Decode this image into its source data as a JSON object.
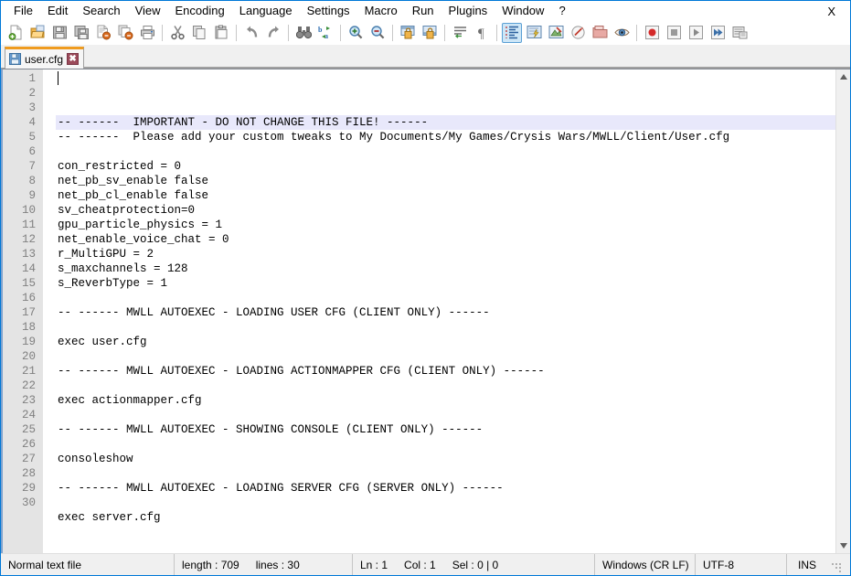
{
  "window": {
    "title": "user.cfg - Notepad++",
    "close_label": "X",
    "accent_color": "#0078d7",
    "tab_active_color": "#ef9b1f"
  },
  "menubar": {
    "items": [
      {
        "name": "file",
        "label": "File"
      },
      {
        "name": "edit",
        "label": "Edit"
      },
      {
        "name": "search",
        "label": "Search"
      },
      {
        "name": "view",
        "label": "View"
      },
      {
        "name": "encoding",
        "label": "Encoding"
      },
      {
        "name": "language",
        "label": "Language"
      },
      {
        "name": "settings",
        "label": "Settings"
      },
      {
        "name": "macro",
        "label": "Macro"
      },
      {
        "name": "run",
        "label": "Run"
      },
      {
        "name": "plugins",
        "label": "Plugins"
      },
      {
        "name": "window",
        "label": "Window"
      },
      {
        "name": "help",
        "label": "?"
      }
    ]
  },
  "toolbar": {
    "buttons": [
      {
        "name": "new-file-icon",
        "title": "New"
      },
      {
        "name": "open-file-icon",
        "title": "Open"
      },
      {
        "name": "save-icon",
        "title": "Save"
      },
      {
        "name": "save-all-icon",
        "title": "Save All"
      },
      {
        "name": "close-file-icon",
        "title": "Close"
      },
      {
        "name": "close-all-files-icon",
        "title": "Close All"
      },
      {
        "name": "print-icon",
        "title": "Print"
      },
      {
        "name": "separator",
        "title": ""
      },
      {
        "name": "cut-icon",
        "title": "Cut"
      },
      {
        "name": "copy-icon",
        "title": "Copy"
      },
      {
        "name": "paste-icon",
        "title": "Paste"
      },
      {
        "name": "separator",
        "title": ""
      },
      {
        "name": "undo-icon",
        "title": "Undo"
      },
      {
        "name": "redo-icon",
        "title": "Redo"
      },
      {
        "name": "separator",
        "title": ""
      },
      {
        "name": "find-icon",
        "title": "Find"
      },
      {
        "name": "replace-icon",
        "title": "Replace"
      },
      {
        "name": "separator",
        "title": ""
      },
      {
        "name": "zoom-in-icon",
        "title": "Zoom In"
      },
      {
        "name": "zoom-out-icon",
        "title": "Zoom Out"
      },
      {
        "name": "separator",
        "title": ""
      },
      {
        "name": "sync-vertical-scroll-icon",
        "title": "Synchronize Vertical Scrolling"
      },
      {
        "name": "sync-horizontal-scroll-icon",
        "title": "Synchronize Horizontal Scrolling"
      },
      {
        "name": "separator",
        "title": ""
      },
      {
        "name": "word-wrap-icon",
        "title": "Word wrap"
      },
      {
        "name": "show-pilcrow-icon",
        "title": "Show Paragraph Marks"
      },
      {
        "name": "separator",
        "title": ""
      },
      {
        "name": "show-all-characters-icon",
        "title": "Show All Characters",
        "active": true
      },
      {
        "name": "show-indent-guide-icon",
        "title": "Show Indent Guide"
      },
      {
        "name": "user-defined-dialog-icon",
        "title": "User Defined Dialogue"
      },
      {
        "name": "document-map-icon",
        "title": "Document Map"
      },
      {
        "name": "function-list-icon",
        "title": "Function List"
      },
      {
        "name": "folder-as-workspace-icon",
        "title": "Folder as Workspace"
      },
      {
        "name": "separator",
        "title": ""
      },
      {
        "name": "record-macro-icon",
        "title": "Start Recording"
      },
      {
        "name": "stop-macro-icon",
        "title": "Stop Recording"
      },
      {
        "name": "play-macro-icon",
        "title": "Playback"
      },
      {
        "name": "play-macro-multiple-icon",
        "title": "Run a Macro Multiple Times"
      },
      {
        "name": "save-macro-icon",
        "title": "Save Current Recorded Macro"
      }
    ]
  },
  "tabs": [
    {
      "name": "tab-user-cfg",
      "label": "user.cfg",
      "icon": "save-floppy-icon",
      "close_label": "✖",
      "active": true
    }
  ],
  "editor": {
    "current_line": 1,
    "total_lines": 30,
    "line_numbers": [
      1,
      2,
      3,
      4,
      5,
      6,
      7,
      8,
      9,
      10,
      11,
      12,
      13,
      14,
      15,
      16,
      17,
      18,
      19,
      20,
      21,
      22,
      23,
      24,
      25,
      26,
      27,
      28,
      29,
      30
    ],
    "lines": [
      "-- ------  IMPORTANT - DO NOT CHANGE THIS FILE! ------",
      "-- ------  Please add your custom tweaks to My Documents/My Games/Crysis Wars/MWLL/Client/User.cfg",
      "",
      "con_restricted = 0",
      "net_pb_sv_enable false",
      "net_pb_cl_enable false",
      "sv_cheatprotection=0",
      "gpu_particle_physics = 1",
      "net_enable_voice_chat = 0",
      "r_MultiGPU = 2",
      "s_maxchannels = 128",
      "s_ReverbType = 1",
      "",
      "-- ------ MWLL AUTOEXEC - LOADING USER CFG (CLIENT ONLY) ------",
      "",
      "exec user.cfg",
      "",
      "-- ------ MWLL AUTOEXEC - LOADING ACTIONMAPPER CFG (CLIENT ONLY) ------",
      "",
      "exec actionmapper.cfg",
      "",
      "-- ------ MWLL AUTOEXEC - SHOWING CONSOLE (CLIENT ONLY) ------",
      "",
      "consoleshow",
      "",
      "-- ------ MWLL AUTOEXEC - LOADING SERVER CFG (SERVER ONLY) ------",
      "",
      "exec server.cfg",
      "",
      ""
    ]
  },
  "statusbar": {
    "file_type": "Normal text file",
    "length_label": "length : 709",
    "lines_label": "lines : 30",
    "ln_label": "Ln : 1",
    "col_label": "Col : 1",
    "sel_label": "Sel : 0 | 0",
    "eol": "Windows (CR LF)",
    "encoding": "UTF-8",
    "insert_mode": "INS"
  }
}
